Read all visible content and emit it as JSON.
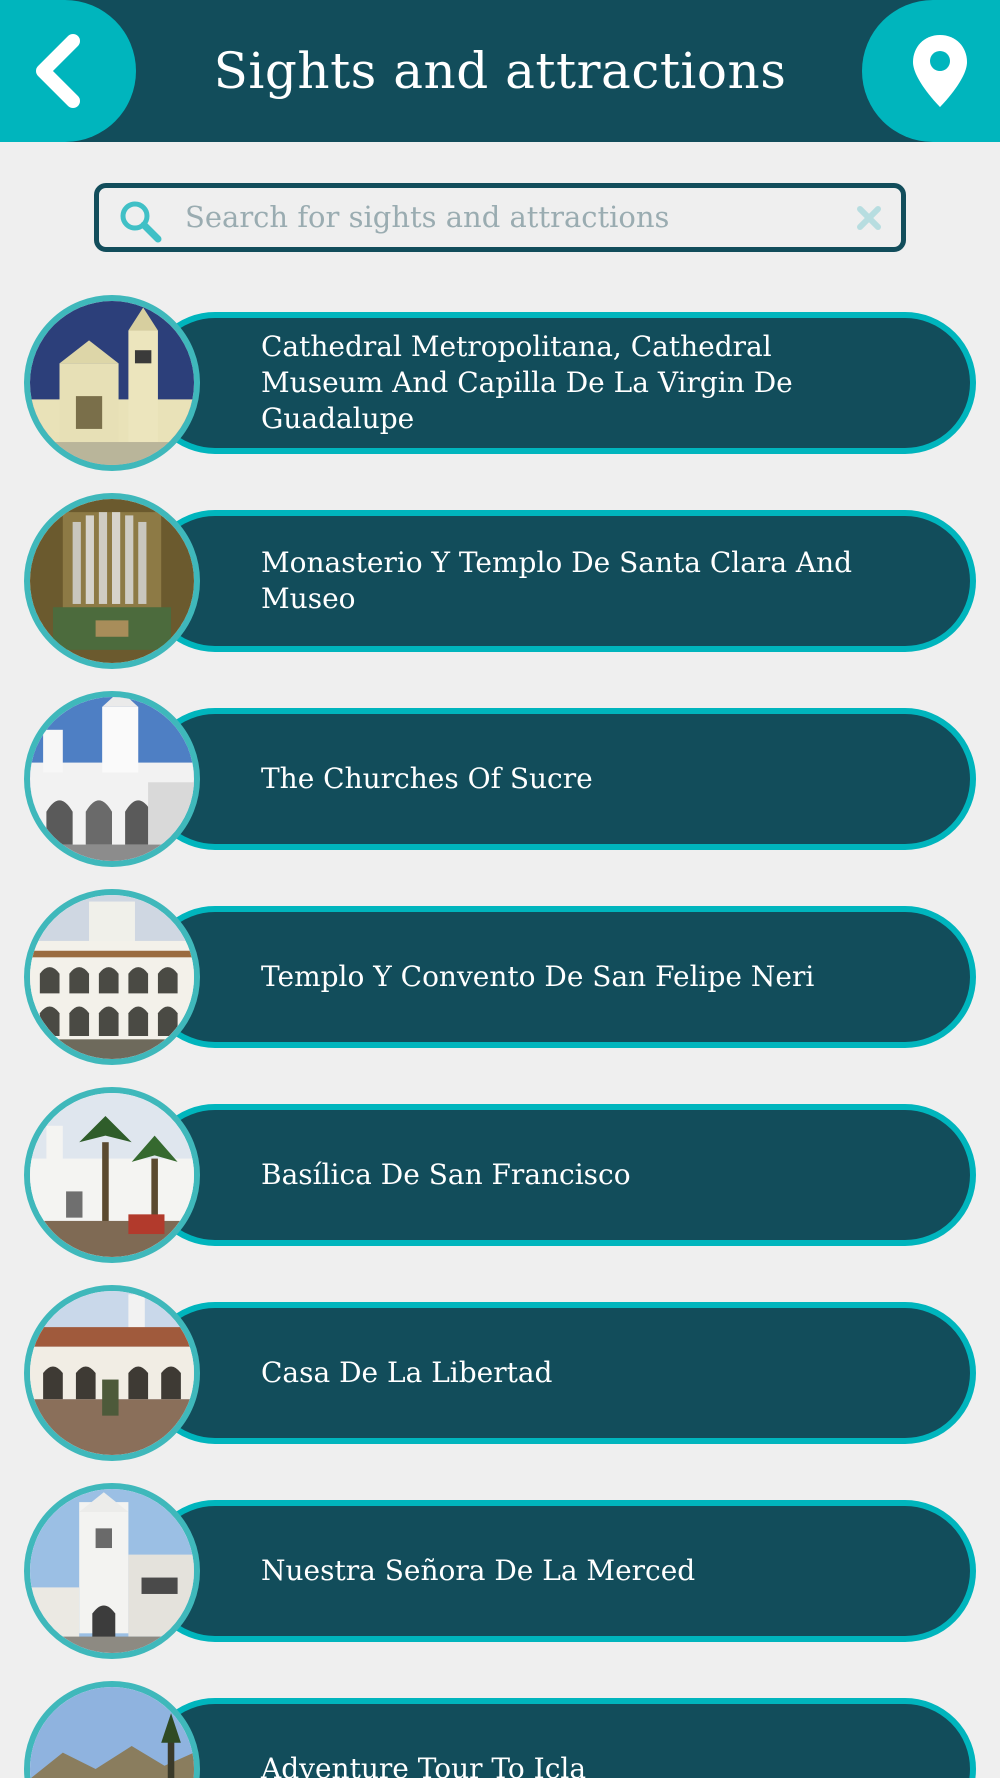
{
  "header": {
    "title": "Sights and attractions",
    "back_icon": "chevron-left-icon",
    "map_icon": "map-pin-icon"
  },
  "search": {
    "placeholder": "Search for sights and attractions",
    "value": "",
    "search_icon": "search-icon",
    "clear_icon": "close-icon"
  },
  "items": [
    {
      "name": "Cathedral Metropolitana, Cathedral Museum And Capilla De La Virgin De Guadalupe"
    },
    {
      "name": "Monasterio Y Templo De Santa Clara And Museo"
    },
    {
      "name": "The Churches Of Sucre"
    },
    {
      "name": "Templo Y Convento De San Felipe Neri"
    },
    {
      "name": "Basílica De San Francisco"
    },
    {
      "name": "Casa De La Libertad"
    },
    {
      "name": "Nuestra Señora De La Merced"
    },
    {
      "name": "Adventure Tour To Icla"
    }
  ],
  "colors": {
    "header": "#124d5b",
    "accent": "#00b5bd",
    "background": "#efefef",
    "pill": "#124d5b"
  }
}
